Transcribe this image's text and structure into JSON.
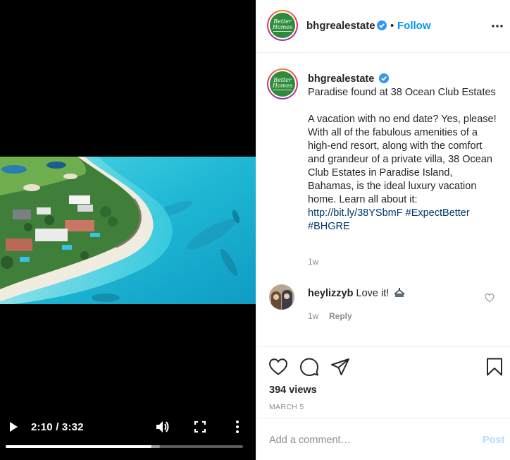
{
  "video": {
    "current_time": "2:10",
    "separator": "/",
    "duration": "3:32",
    "time_display": "2:10 / 3:32",
    "progress_fraction": 0.613,
    "buffered_fraction": 0.65
  },
  "header": {
    "avatar_text_line1": "Better",
    "avatar_text_line2": "Homes",
    "username": "bhgrealestate",
    "dot": "•",
    "follow_label": "Follow"
  },
  "caption": {
    "username": "bhgrealestate",
    "title": "Paradise found at 38 Ocean Club Estates",
    "body": "A vacation with no end date? Yes, please! With all of the fabulous amenities of a high-end resort, along with the comfort and grandeur of a private villa, 38 Ocean Club Estates in Paradise Island, Bahamas, is the ideal luxury vacation home. Learn all about it: ",
    "link": "http://bit.ly/38YSbmF",
    "hashtags": "#ExpectBetter #BHGRE",
    "age": "1w"
  },
  "comment": {
    "username": "heylizzyb",
    "text": "Love it!",
    "age": "1w",
    "reply_label": "Reply"
  },
  "actions": {
    "views": "394 views",
    "date": "MARCH 5"
  },
  "add_comment": {
    "placeholder": "Add a comment…",
    "post_label": "Post"
  },
  "colors": {
    "accent": "#0095f6",
    "post_disabled": "#b2dffc",
    "link": "#00376b",
    "brand_green": "#2e8b3a",
    "muted": "#8e8e8e"
  },
  "icons": {
    "play": "play-icon",
    "volume": "volume-icon",
    "fullscreen": "fullscreen-icon",
    "more": "more-vertical-icon",
    "verified": "verified-badge-icon",
    "like": "heart-icon",
    "comment": "comment-bubble-icon",
    "share": "paper-plane-icon",
    "save": "bookmark-icon"
  }
}
